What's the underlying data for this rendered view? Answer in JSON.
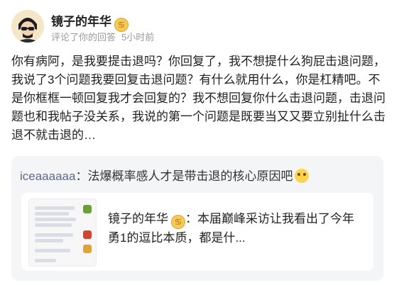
{
  "user": {
    "name": "镜子的年华",
    "zodiac_icon": "cancer-zodiac-icon",
    "action": "评论了你的回答",
    "time": "5小时前"
  },
  "comment": {
    "text": "你有病阿，是我要提击退吗？你回复了，我不想提什么狗屁击退问题，我说了3个问题我要回复击退问题？有什么就用什么，你是杠精吧。不是你框框一顿回复我才会回复的？我不想回复你什么击退问题，击退问题也和我帖子没关系，我说的第一个问题是既要当又又要立别扯什么击退不就击退的…"
  },
  "quote": {
    "name": "iceaaaaaa",
    "separator": "：",
    "text": "法爆概率感人才是带击退的核心原因吧",
    "emoji": "smirk-emoji-icon"
  },
  "card": {
    "name": "镜子的年华",
    "separator": "：",
    "text": "本届巅峰采访让我看出了今年勇1的逗比本质，都是什..."
  },
  "colors": {
    "quote_name": "#5b6b8a",
    "quote_bg": "#f4f5f7",
    "meta": "#9a9a9a"
  }
}
